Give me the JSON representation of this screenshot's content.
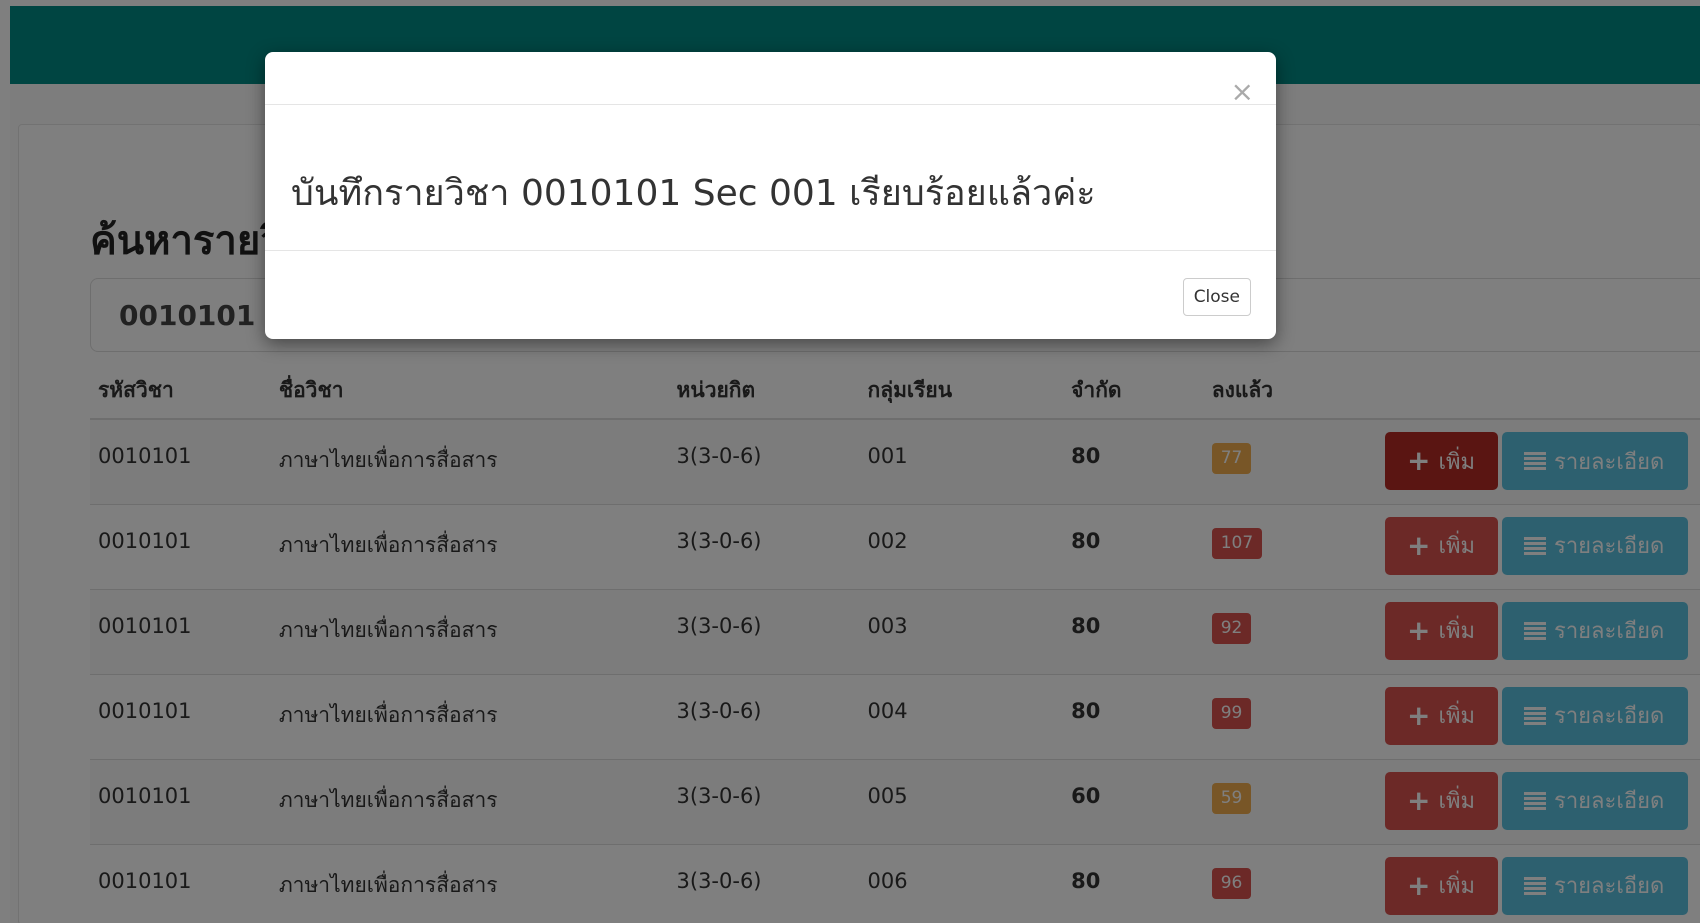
{
  "search": {
    "title": "ค้นหารายวิชา",
    "value": "0010101"
  },
  "table": {
    "headers": {
      "code": "รหัสวิชา",
      "name": "ชื่อวิชา",
      "credit": "หน่วยกิต",
      "section": "กลุ่มเรียน",
      "limit": "จำกัด",
      "enrolled": "ลงแล้ว"
    },
    "rows": [
      {
        "code": "0010101",
        "name": "ภาษาไทยเพื่อการสื่อสาร",
        "credit": "3(3-0-6)",
        "section": "001",
        "limit": "80",
        "enrolled": "77",
        "badge_color": "#f0ad4e"
      },
      {
        "code": "0010101",
        "name": "ภาษาไทยเพื่อการสื่อสาร",
        "credit": "3(3-0-6)",
        "section": "002",
        "limit": "80",
        "enrolled": "107",
        "badge_color": "#d9534f"
      },
      {
        "code": "0010101",
        "name": "ภาษาไทยเพื่อการสื่อสาร",
        "credit": "3(3-0-6)",
        "section": "003",
        "limit": "80",
        "enrolled": "92",
        "badge_color": "#d9534f"
      },
      {
        "code": "0010101",
        "name": "ภาษาไทยเพื่อการสื่อสาร",
        "credit": "3(3-0-6)",
        "section": "004",
        "limit": "80",
        "enrolled": "99",
        "badge_color": "#d9534f"
      },
      {
        "code": "0010101",
        "name": "ภาษาไทยเพื่อการสื่อสาร",
        "credit": "3(3-0-6)",
        "section": "005",
        "limit": "60",
        "enrolled": "59",
        "badge_color": "#f0ad4e"
      },
      {
        "code": "0010101",
        "name": "ภาษาไทยเพื่อการสื่อสาร",
        "credit": "3(3-0-6)",
        "section": "006",
        "limit": "80",
        "enrolled": "96",
        "badge_color": "#d9534f"
      }
    ],
    "add_label": "เพิ่ม",
    "detail_label": "รายละเอียด"
  },
  "modal": {
    "message": "บันทึกรายวิชา 0010101 Sec 001 เรียบร้อยแล้วค่ะ",
    "close_label": "Close",
    "close_x": "×"
  },
  "colors": {
    "topbar": "#008a84",
    "add_button": "#d9534f",
    "detail_button": "#5bc0de",
    "badge_warning": "#f0ad4e",
    "badge_danger": "#d9534f"
  }
}
